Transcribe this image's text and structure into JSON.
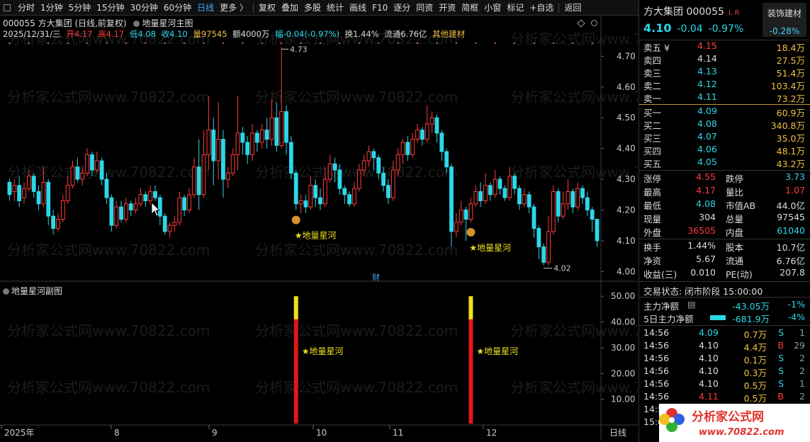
{
  "toolbar": {
    "items": [
      "分时",
      "1分钟",
      "5分钟",
      "15分钟",
      "30分钟",
      "60分钟",
      "日线",
      "更多 〉",
      "复权",
      "叠加",
      "多股",
      "统计",
      "画线",
      "F10",
      "逐分",
      "同资",
      "开资",
      "简框",
      "小窗",
      "标记",
      "+自选",
      "返回"
    ],
    "active": "日线"
  },
  "header": {
    "title": "000055 方大集团 (日线,前复权)",
    "indicator_main": "地量星河主图",
    "date": "2025/12/31/三",
    "open": "开4.17",
    "high": "高4.17",
    "low": "低4.08",
    "close": "收4.10",
    "volume": "量97545",
    "amount": "额4000万",
    "change": "幅-0.04(-0.97%)",
    "turnover": "换1.44%",
    "float": "流通6.76亿",
    "sector": "其他建材"
  },
  "sub_header": {
    "indicator_sub": "地量星河副图"
  },
  "chart_data": [
    {
      "type": "candlestick",
      "y_ticks": [
        "4.70",
        "4.60",
        "4.50",
        "4.40",
        "4.30",
        "4.20",
        "4.10",
        "4.00"
      ],
      "ylim": [
        3.98,
        4.74
      ],
      "x_ticks": [
        "2025年",
        "8",
        "9",
        "10",
        "11",
        "12"
      ],
      "period_label": "日线",
      "candles": [
        [
          4.29,
          4.25,
          4.3,
          4.23
        ],
        [
          4.26,
          4.28,
          4.3,
          4.23
        ],
        [
          4.28,
          4.23,
          4.31,
          4.21
        ],
        [
          4.24,
          4.27,
          4.29,
          4.22
        ],
        [
          4.27,
          4.31,
          4.33,
          4.26
        ],
        [
          4.31,
          4.26,
          4.32,
          4.24
        ],
        [
          4.26,
          4.22,
          4.28,
          4.2
        ],
        [
          4.22,
          4.29,
          4.34,
          4.21
        ],
        [
          4.29,
          4.18,
          4.3,
          4.15
        ],
        [
          4.18,
          4.14,
          4.2,
          4.12
        ],
        [
          4.14,
          4.17,
          4.19,
          4.13
        ],
        [
          4.17,
          4.23,
          4.25,
          4.16
        ],
        [
          4.23,
          4.28,
          4.31,
          4.22
        ],
        [
          4.28,
          4.34,
          4.36,
          4.27
        ],
        [
          4.34,
          4.3,
          4.37,
          4.29
        ],
        [
          4.3,
          4.32,
          4.34,
          4.28
        ],
        [
          4.32,
          4.38,
          4.4,
          4.31
        ],
        [
          4.38,
          4.33,
          4.39,
          4.31
        ],
        [
          4.33,
          4.36,
          4.39,
          4.32
        ],
        [
          4.36,
          4.3,
          4.37,
          4.28
        ],
        [
          4.3,
          4.24,
          4.32,
          4.22
        ],
        [
          4.24,
          4.15,
          4.25,
          4.13
        ],
        [
          4.15,
          4.21,
          4.23,
          4.14
        ],
        [
          4.21,
          4.17,
          4.23,
          4.16
        ],
        [
          4.17,
          4.22,
          4.24,
          4.16
        ],
        [
          4.22,
          4.2,
          4.23,
          4.18
        ],
        [
          4.2,
          4.22,
          4.24,
          4.19
        ],
        [
          4.22,
          4.25,
          4.27,
          4.21
        ],
        [
          4.25,
          4.23,
          4.26,
          4.21
        ],
        [
          4.23,
          4.26,
          4.28,
          4.22
        ],
        [
          4.26,
          4.24,
          4.28,
          4.23
        ],
        [
          4.24,
          4.18,
          4.25,
          4.15
        ],
        [
          4.18,
          4.13,
          4.19,
          4.12
        ],
        [
          4.13,
          4.15,
          4.16,
          4.11
        ],
        [
          4.15,
          4.16,
          4.18,
          4.13
        ],
        [
          4.16,
          4.24,
          4.26,
          4.15
        ],
        [
          4.24,
          4.2,
          4.25,
          4.18
        ],
        [
          4.2,
          4.25,
          4.27,
          4.19
        ],
        [
          4.25,
          4.34,
          4.37,
          4.24
        ],
        [
          4.34,
          4.25,
          4.43,
          4.2
        ],
        [
          4.25,
          4.38,
          4.46,
          4.24
        ],
        [
          4.38,
          4.46,
          4.57,
          4.33
        ],
        [
          4.46,
          4.36,
          4.5,
          4.28
        ],
        [
          4.36,
          4.43,
          4.55,
          4.3
        ],
        [
          4.43,
          4.3,
          4.46,
          4.24
        ],
        [
          4.3,
          4.32,
          4.34,
          4.27
        ],
        [
          4.32,
          4.38,
          4.4,
          4.31
        ],
        [
          4.38,
          4.45,
          4.57,
          4.33
        ],
        [
          4.45,
          4.42,
          4.47,
          4.38
        ],
        [
          4.42,
          4.38,
          4.44,
          4.35
        ],
        [
          4.38,
          4.45,
          4.48,
          4.36
        ],
        [
          4.45,
          4.42,
          4.46,
          4.39
        ],
        [
          4.42,
          4.46,
          4.48,
          4.4
        ],
        [
          4.46,
          4.43,
          4.5,
          4.4
        ],
        [
          4.43,
          4.5,
          4.56,
          4.41
        ],
        [
          4.5,
          4.41,
          4.55,
          4.39
        ],
        [
          4.41,
          4.52,
          4.73,
          4.4
        ],
        [
          4.52,
          4.42,
          4.54,
          4.38
        ],
        [
          4.42,
          4.32,
          4.44,
          4.3
        ],
        [
          4.32,
          4.22,
          4.33,
          4.2
        ],
        [
          4.22,
          4.23,
          4.25,
          4.19
        ],
        [
          4.23,
          4.21,
          4.25,
          4.19
        ],
        [
          4.21,
          4.28,
          4.31,
          4.2
        ],
        [
          4.28,
          4.24,
          4.3,
          4.21
        ],
        [
          4.24,
          4.22,
          4.27,
          4.2
        ],
        [
          4.22,
          4.3,
          4.34,
          4.21
        ],
        [
          4.3,
          4.35,
          4.38,
          4.29
        ],
        [
          4.35,
          4.33,
          4.37,
          4.29
        ],
        [
          4.33,
          4.27,
          4.35,
          4.25
        ],
        [
          4.27,
          4.25,
          4.28,
          4.22
        ],
        [
          4.25,
          4.22,
          4.26,
          4.21
        ],
        [
          4.22,
          4.27,
          4.29,
          4.21
        ],
        [
          4.27,
          4.33,
          4.35,
          4.26
        ],
        [
          4.33,
          4.36,
          4.38,
          4.31
        ],
        [
          4.36,
          4.39,
          4.41,
          4.34
        ],
        [
          4.39,
          4.37,
          4.4,
          4.33
        ],
        [
          4.37,
          4.32,
          4.38,
          4.3
        ],
        [
          4.32,
          4.28,
          4.34,
          4.26
        ],
        [
          4.28,
          4.24,
          4.3,
          4.22
        ],
        [
          4.24,
          4.33,
          4.36,
          4.23
        ],
        [
          4.33,
          4.38,
          4.4,
          4.31
        ],
        [
          4.38,
          4.42,
          4.43,
          4.35
        ],
        [
          4.42,
          4.38,
          4.44,
          4.36
        ],
        [
          4.38,
          4.43,
          4.45,
          4.37
        ],
        [
          4.43,
          4.46,
          4.48,
          4.42
        ],
        [
          4.46,
          4.43,
          4.47,
          4.41
        ],
        [
          4.43,
          4.48,
          4.54,
          4.42
        ],
        [
          4.48,
          4.5,
          4.52,
          4.45
        ],
        [
          4.5,
          4.45,
          4.51,
          4.42
        ],
        [
          4.45,
          4.39,
          4.46,
          4.36
        ],
        [
          4.39,
          4.34,
          4.4,
          4.32
        ],
        [
          4.34,
          4.13,
          4.35,
          4.08
        ],
        [
          4.13,
          4.16,
          4.19,
          4.11
        ],
        [
          4.16,
          4.2,
          4.23,
          4.15
        ],
        [
          4.2,
          4.17,
          4.21,
          4.1
        ],
        [
          4.17,
          4.22,
          4.24,
          4.16
        ],
        [
          4.22,
          4.26,
          4.28,
          4.21
        ],
        [
          4.26,
          4.23,
          4.29,
          4.21
        ],
        [
          4.23,
          4.28,
          4.32,
          4.22
        ],
        [
          4.28,
          4.25,
          4.29,
          4.23
        ],
        [
          4.25,
          4.3,
          4.33,
          4.24
        ],
        [
          4.3,
          4.27,
          4.31,
          4.25
        ],
        [
          4.27,
          4.24,
          4.28,
          4.23
        ],
        [
          4.24,
          4.31,
          4.34,
          4.23
        ],
        [
          4.31,
          4.27,
          4.32,
          4.25
        ],
        [
          4.27,
          4.22,
          4.28,
          4.2
        ],
        [
          4.22,
          4.25,
          4.27,
          4.21
        ],
        [
          4.25,
          4.21,
          4.26,
          4.19
        ],
        [
          4.21,
          4.14,
          4.22,
          4.11
        ],
        [
          4.14,
          4.08,
          4.15,
          4.04
        ],
        [
          4.08,
          4.03,
          4.09,
          4.02
        ],
        [
          4.03,
          4.13,
          4.18,
          4.02
        ],
        [
          4.13,
          4.26,
          4.28,
          4.12
        ],
        [
          4.26,
          4.18,
          4.27,
          4.16
        ],
        [
          4.18,
          4.22,
          4.26,
          4.17
        ],
        [
          4.22,
          4.26,
          4.3,
          4.2
        ],
        [
          4.26,
          4.21,
          4.27,
          4.19
        ],
        [
          4.21,
          4.27,
          4.29,
          4.2
        ],
        [
          4.27,
          4.24,
          4.28,
          4.22
        ],
        [
          4.24,
          4.2,
          4.26,
          4.18
        ],
        [
          4.2,
          4.17,
          4.21,
          4.13
        ],
        [
          4.17,
          4.1,
          4.17,
          4.08
        ]
      ],
      "annotations": [
        {
          "text": "4.73",
          "price": 4.73
        },
        {
          "text": "4.02",
          "price": 4.02
        },
        {
          "text": "★地量星河",
          "index": 59
        },
        {
          "text": "★地量星河",
          "index": 95
        }
      ],
      "bottom_marker": "财"
    },
    {
      "type": "bar",
      "y_ticks": [
        "50.00",
        "40.00",
        "30.00",
        "20.00",
        "10.00"
      ],
      "ylim": [
        0,
        55
      ],
      "signals": [
        {
          "index": 59,
          "value": 50,
          "label": "★地量星河"
        },
        {
          "index": 95,
          "value": 50,
          "label": "★地量星河"
        }
      ]
    }
  ],
  "quote": {
    "name_code": "方大集团 000055",
    "lr": "L R",
    "sector_tag": "装饰建材",
    "sector_pct": "-0.28%",
    "price": "4.10",
    "change": "-0.04",
    "pct": "-0.97%",
    "asks": [
      {
        "label": "卖五 ¥",
        "price": "4.15",
        "vol": "18.4万"
      },
      {
        "label": "卖四",
        "price": "4.14",
        "vol": "27.5万"
      },
      {
        "label": "卖三",
        "price": "4.13",
        "vol": "51.4万"
      },
      {
        "label": "卖二",
        "price": "4.12",
        "vol": "103.4万"
      },
      {
        "label": "卖一",
        "price": "4.11",
        "vol": "73.2万"
      }
    ],
    "bids": [
      {
        "label": "买一",
        "price": "4.09",
        "vol": "60.9万"
      },
      {
        "label": "买二",
        "price": "4.08",
        "vol": "340.8万"
      },
      {
        "label": "买三",
        "price": "4.07",
        "vol": "35.0万"
      },
      {
        "label": "买四",
        "price": "4.06",
        "vol": "48.1万"
      },
      {
        "label": "买五",
        "price": "4.05",
        "vol": "43.2万"
      }
    ],
    "stats": [
      {
        "k1": "涨停",
        "v1": "4.55",
        "k2": "跌停",
        "v2": "3.73"
      },
      {
        "k1": "最高",
        "v1": "4.17",
        "k2": "量比",
        "v2": "1.07"
      },
      {
        "k1": "最低",
        "v1": "4.08",
        "k2": "市值AB",
        "v2": "44.0亿"
      },
      {
        "k1": "现量",
        "v1": "304",
        "k2": "总量",
        "v2": "97545"
      },
      {
        "k1": "外盘",
        "v1": "36505",
        "k2": "内盘",
        "v2": "61040"
      }
    ],
    "fin": [
      {
        "k1": "换手",
        "v1": "1.44%",
        "k2": "股本",
        "v2": "10.7亿"
      },
      {
        "k1": "净资",
        "v1": "5.67",
        "k2": "流通",
        "v2": "6.76亿"
      },
      {
        "k1": "收益(三)",
        "v1": "0.010",
        "k2": "PE(动)",
        "v2": "207.8"
      }
    ],
    "trade_status": "交易状态: 闭市阶段 15:00:00",
    "main_net": {
      "label": "主力净额",
      "value": "-43.05万",
      "pct": "-1%"
    },
    "main_net5": {
      "label": "5日主力净额",
      "value": "-681.9万",
      "pct": "-4%"
    },
    "ticks": [
      {
        "t": "14:56",
        "p": "4.09",
        "v": "0.7万",
        "s": "S",
        "n": "1"
      },
      {
        "t": "14:56",
        "p": "4.10",
        "v": "4.4万",
        "s": "B",
        "n": "29"
      },
      {
        "t": "14:56",
        "p": "4.10",
        "v": "0.1万",
        "s": "S",
        "n": "2"
      },
      {
        "t": "14:56",
        "p": "4.10",
        "v": "0.3万",
        "s": "S",
        "n": "2"
      },
      {
        "t": "14:56",
        "p": "4.10",
        "v": "0.5万",
        "s": "S",
        "n": "1"
      },
      {
        "t": "14:56",
        "p": "4.11",
        "v": "0.5万",
        "s": "B",
        "n": "2"
      },
      {
        "t": "14:5",
        "p": "",
        "v": "",
        "s": "",
        "n": ""
      },
      {
        "t": "15:0",
        "p": "",
        "v": "",
        "s": "",
        "n": ""
      }
    ]
  },
  "watermark": "分析家公式网www.70822.com",
  "logo": {
    "text": "分析家公式网",
    "url": "www.70822.com"
  }
}
